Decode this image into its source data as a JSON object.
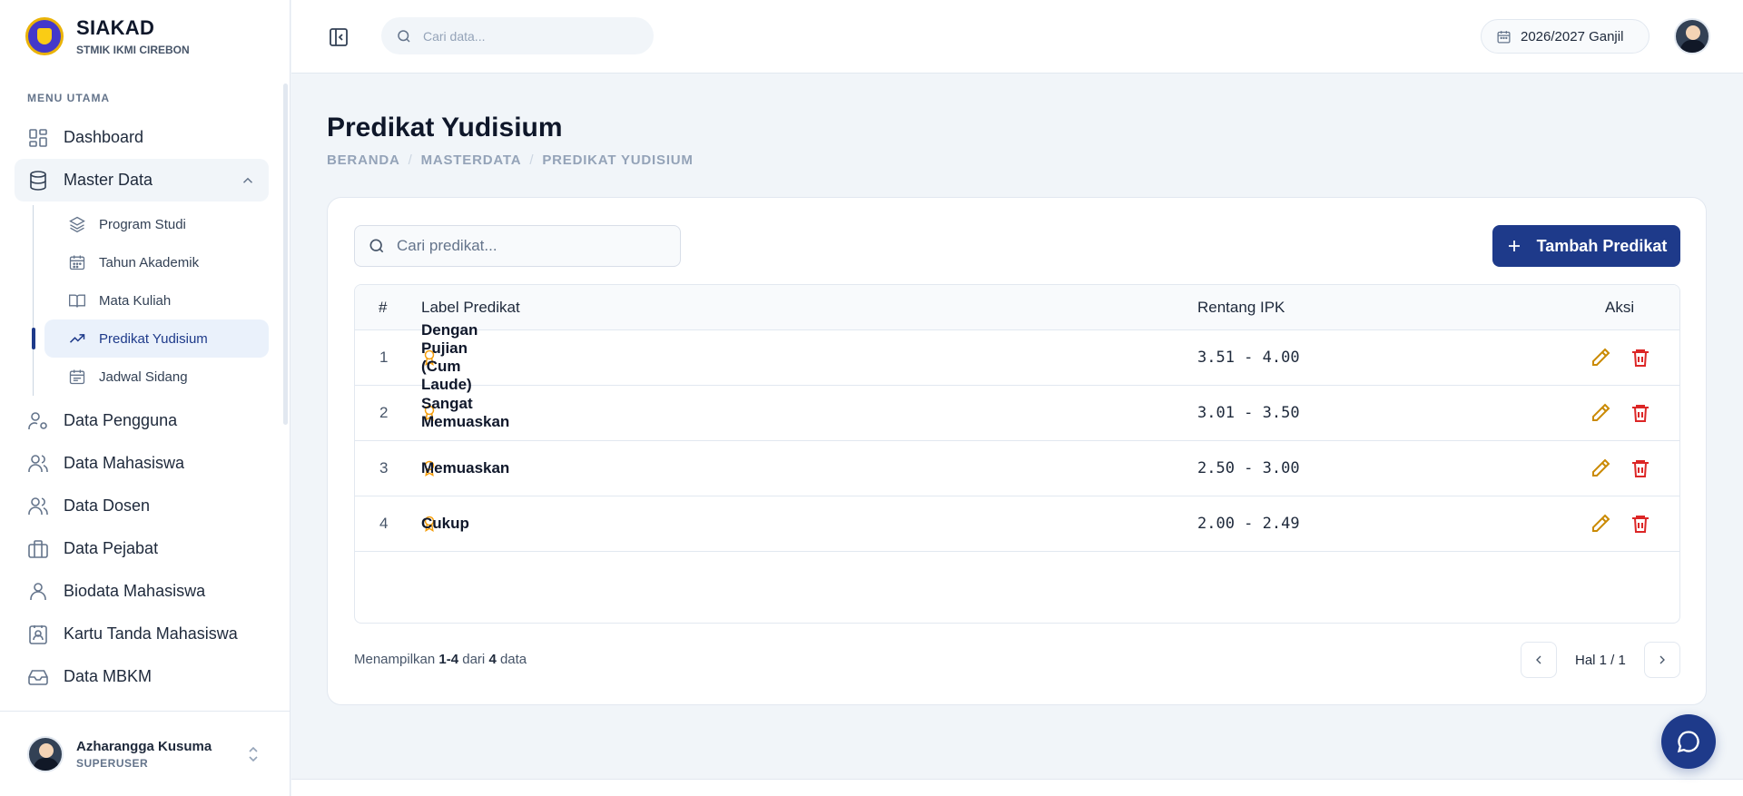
{
  "brand": {
    "title": "SIAKAD",
    "subtitle": "STMIK IKMI CIREBON"
  },
  "sidebar": {
    "menu_label": "MENU UTAMA",
    "items": [
      {
        "label": "Dashboard",
        "icon": "grid-icon"
      },
      {
        "label": "Master Data",
        "icon": "database-icon",
        "expanded": true,
        "children": [
          {
            "label": "Program Studi",
            "icon": "layers-icon"
          },
          {
            "label": "Tahun Akademik",
            "icon": "calendar-icon"
          },
          {
            "label": "Mata Kuliah",
            "icon": "book-open-icon"
          },
          {
            "label": "Predikat Yudisium",
            "icon": "trending-up-icon",
            "active": true
          },
          {
            "label": "Jadwal Sidang",
            "icon": "calendar-check-icon"
          }
        ]
      },
      {
        "label": "Data Pengguna",
        "icon": "user-cog-icon"
      },
      {
        "label": "Data Mahasiswa",
        "icon": "users-icon"
      },
      {
        "label": "Data Dosen",
        "icon": "users-icon"
      },
      {
        "label": "Data Pejabat",
        "icon": "briefcase-icon"
      },
      {
        "label": "Biodata Mahasiswa",
        "icon": "user-icon"
      },
      {
        "label": "Kartu Tanda Mahasiswa",
        "icon": "id-card-icon"
      },
      {
        "label": "Data MBKM",
        "icon": "inbox-icon"
      }
    ]
  },
  "user": {
    "name": "Azharangga Kusuma",
    "role": "SUPERUSER"
  },
  "header": {
    "search_placeholder": "Cari data...",
    "academic_year": "2026/2027 Ganjil"
  },
  "page": {
    "title": "Predikat Yudisium",
    "breadcrumb": [
      "BERANDA",
      "MASTERDATA",
      "PREDIKAT YUDISIUM"
    ],
    "breadcrumb_sep": "/"
  },
  "table": {
    "search_placeholder": "Cari predikat...",
    "add_button": "Tambah Predikat",
    "columns": {
      "no": "#",
      "label": "Label Predikat",
      "range": "Rentang IPK",
      "actions": "Aksi"
    },
    "rows": [
      {
        "no": "1",
        "label": "Dengan Pujian (Cum Laude)",
        "range": "3.51 - 4.00"
      },
      {
        "no": "2",
        "label": "Sangat Memuaskan",
        "range": "3.01 - 3.50"
      },
      {
        "no": "3",
        "label": "Memuaskan",
        "range": "2.50 - 3.00"
      },
      {
        "no": "4",
        "label": "Cukup",
        "range": "2.00 - 2.49"
      }
    ]
  },
  "footer": {
    "summary_prefix": "Menampilkan",
    "summary_range": "1-4",
    "summary_mid": "dari",
    "summary_total": "4",
    "summary_suffix": "data",
    "page_indicator": "Hal 1 / 1"
  },
  "colors": {
    "primary": "#1e3a8a",
    "edit": "#ca8a04",
    "delete": "#dc2626",
    "award": "#f59e0b"
  }
}
